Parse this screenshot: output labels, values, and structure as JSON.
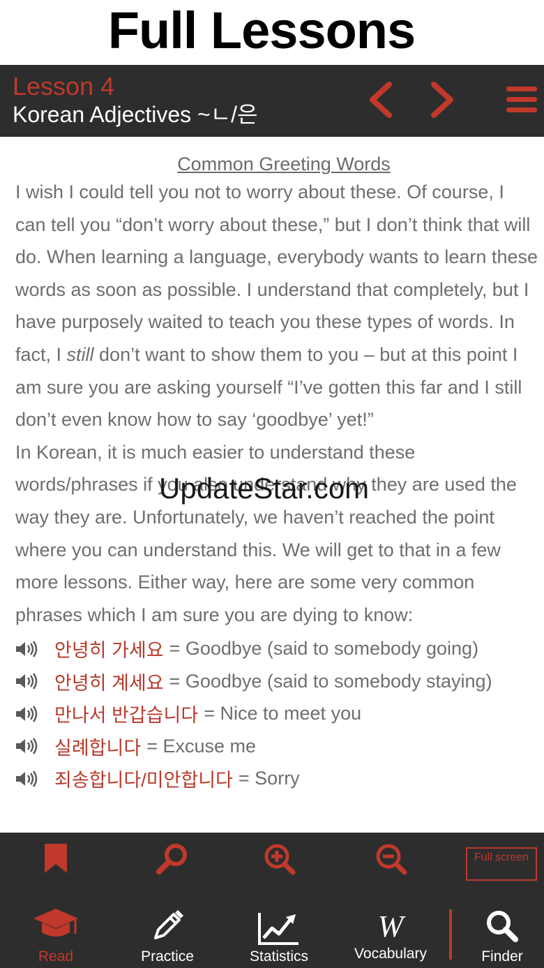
{
  "banner": {
    "title": "Full Lessons"
  },
  "header": {
    "lesson_number": "Lesson 4",
    "lesson_title": "Korean Adjectives ~ㄴ/은",
    "prev_icon": "chevron-left-icon",
    "next_icon": "chevron-right-icon",
    "menu_icon": "hamburger-menu-icon"
  },
  "content": {
    "section_title": "Common Greeting Words",
    "paragraph1_before": "I wish I could tell you not to worry about these. Of course, I can tell you “don’t worry about these,” but I don’t think that will do. When learning a language, everybody wants to learn these words as soon as possible. I understand that completely, but I have purposely waited to teach you these types of words. In fact, I ",
    "paragraph1_italic": "still",
    "paragraph1_after": " don’t want to show them to you – but at this point I am sure you are asking yourself “I’ve gotten this far and I still don’t even know how to say ‘goodbye’ yet!”",
    "paragraph2": "In Korean, it is much easier to understand these words/phrases if you also understand why they are used the way they are. Unfortunately, we haven’t reached the point where you can understand this. We will get to that in a few more lessons. Either way, here are some very common phrases which I am sure you are dying to know:",
    "phrases": [
      {
        "korean": "안녕히 가세요",
        "english": "= Goodbye (said to somebody going)"
      },
      {
        "korean": "안녕히 계세요",
        "english": "= Goodbye (said to somebody staying)"
      },
      {
        "korean": "만나서 반갑습니다",
        "english": "= Nice to meet you"
      },
      {
        "korean": "실례합니다",
        "english": "= Excuse me"
      },
      {
        "korean": "죄송합니다/미안합니다",
        "english": "= Sorry"
      }
    ]
  },
  "watermark": "UpdateStar.com",
  "toolbar": {
    "bookmark_icon": "bookmark-icon",
    "search_icon": "search-icon",
    "zoom_in_icon": "zoom-in-icon",
    "zoom_out_icon": "zoom-out-icon",
    "fullscreen_label": "Full screen"
  },
  "bottom_nav": {
    "items": [
      {
        "label": "Read",
        "icon": "graduation-cap-icon",
        "active": true
      },
      {
        "label": "Practice",
        "icon": "pencil-icon",
        "active": false
      },
      {
        "label": "Statistics",
        "icon": "line-chart-icon",
        "active": false
      },
      {
        "label": "Vocabulary",
        "icon": "vocabulary-w-icon",
        "active": false
      },
      {
        "label": "Finder",
        "icon": "search-icon",
        "active": false
      }
    ]
  },
  "colors": {
    "accent": "#c0392b",
    "bar": "#2d2d2d",
    "body_text": "#6e6e6e"
  }
}
